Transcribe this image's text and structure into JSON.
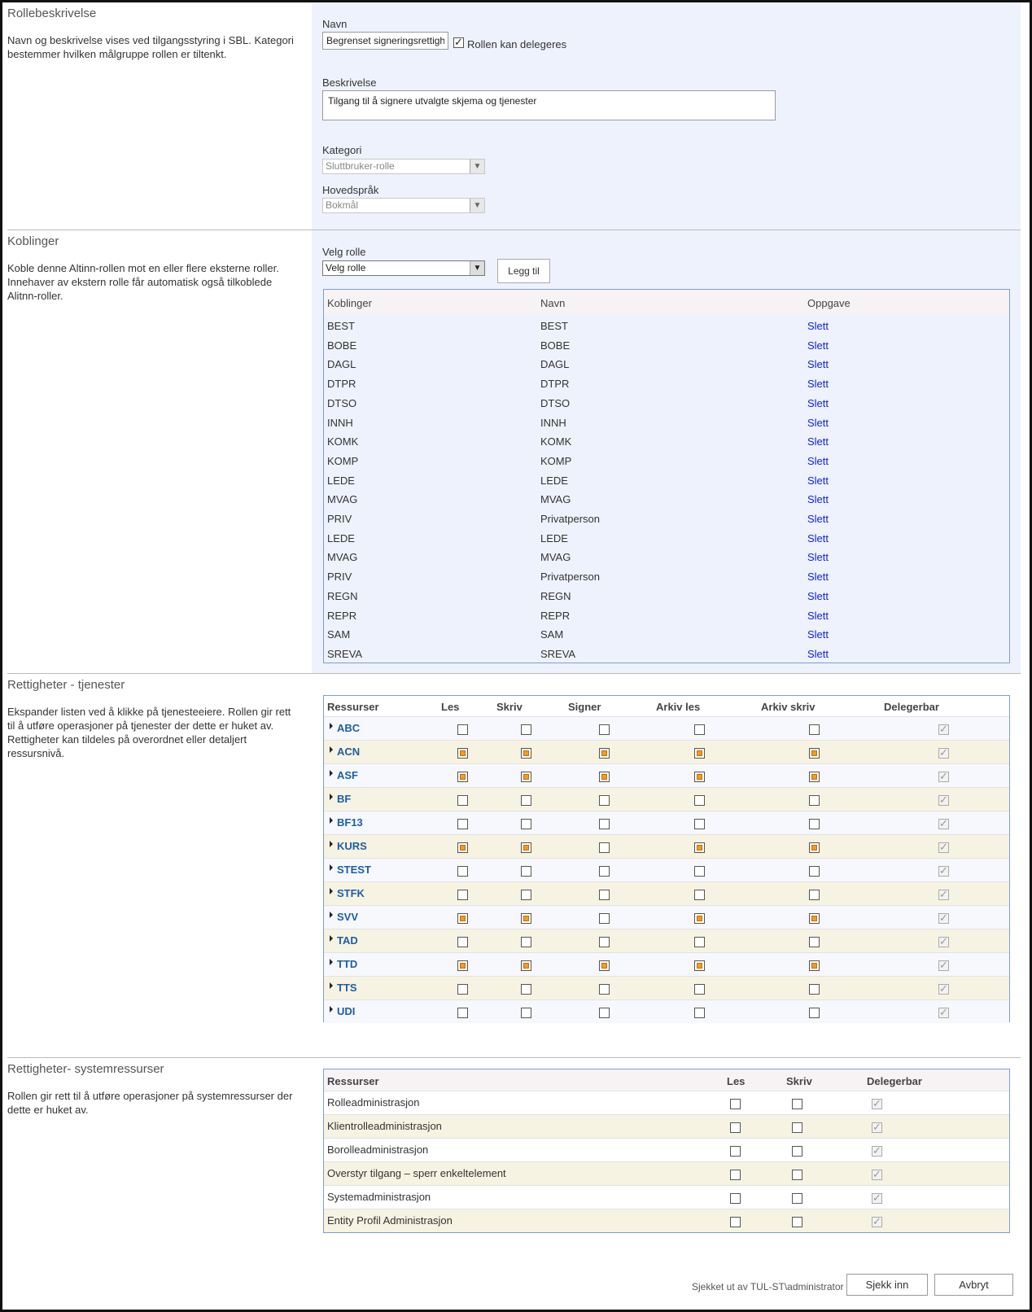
{
  "rollebeskrivelse": {
    "title": "Rollebeskrivelse",
    "description": "Navn og beskrivelse vises ved tilgangsstyring i SBL. Kategori bestemmer hvilken målgruppe rollen er tiltenkt.",
    "navn_label": "Navn",
    "navn_value": "Begrenset signeringsrettigheter",
    "delegeres_label": "Rollen kan delegeres",
    "beskrivelse_label": "Beskrivelse",
    "beskrivelse_value": "Tilgang til å signere utvalgte skjema og tjenester",
    "kategori_label": "Kategori",
    "kategori_value": "Sluttbruker-rolle",
    "hovedsprak_label": "Hovedspråk",
    "hovedsprak_value": "Bokmål"
  },
  "koblinger": {
    "title": "Koblinger",
    "description": "Koble denne Altinn-rollen mot en eller flere eksterne roller. Innehaver av ekstern rolle får automatisk også tilkoblede Alitnn-roller.",
    "velg_label": "Velg rolle",
    "velg_value": "Velg rolle",
    "add_button": "Legg til",
    "columns": [
      "Koblinger",
      "Navn",
      "Oppgave"
    ],
    "rows": [
      {
        "kobling": "BEST",
        "navn": "BEST",
        "action": "Slett"
      },
      {
        "kobling": "BOBE",
        "navn": "BOBE",
        "action": "Slett"
      },
      {
        "kobling": "DAGL",
        "navn": "DAGL",
        "action": "Slett"
      },
      {
        "kobling": "DTPR",
        "navn": "DTPR",
        "action": "Slett"
      },
      {
        "kobling": "DTSO",
        "navn": "DTSO",
        "action": "Slett"
      },
      {
        "kobling": "INNH",
        "navn": "INNH",
        "action": "Slett"
      },
      {
        "kobling": "KOMK",
        "navn": "KOMK",
        "action": "Slett"
      },
      {
        "kobling": "KOMP",
        "navn": "KOMP",
        "action": "Slett"
      },
      {
        "kobling": "LEDE",
        "navn": "LEDE",
        "action": "Slett"
      },
      {
        "kobling": "MVAG",
        "navn": "MVAG",
        "action": "Slett"
      },
      {
        "kobling": "PRIV",
        "navn": "Privatperson",
        "action": "Slett"
      },
      {
        "kobling": "LEDE",
        "navn": "LEDE",
        "action": "Slett"
      },
      {
        "kobling": "MVAG",
        "navn": "MVAG",
        "action": "Slett"
      },
      {
        "kobling": "PRIV",
        "navn": "Privatperson",
        "action": "Slett"
      },
      {
        "kobling": "REGN",
        "navn": "REGN",
        "action": "Slett"
      },
      {
        "kobling": "REPR",
        "navn": "REPR",
        "action": "Slett"
      },
      {
        "kobling": "SAM",
        "navn": "SAM",
        "action": "Slett"
      },
      {
        "kobling": "SREVA",
        "navn": "SREVA",
        "action": "Slett"
      }
    ]
  },
  "tjenester": {
    "title": "Rettigheter - tjenester",
    "description": "Ekspander listen ved å klikke på tjenesteeiere. Rollen gir rett til å utføre operasjoner på tjenester der dette er huket av. Rettigheter kan tildeles på overordnet eller detaljert ressursnivå.",
    "columns": [
      "Ressurser",
      "Les",
      "Skriv",
      "Signer",
      "Arkiv les",
      "Arkiv skriv",
      "Delegerbar"
    ],
    "rows": [
      {
        "name": "ABC",
        "states": [
          "empty",
          "empty",
          "empty",
          "empty",
          "empty"
        ]
      },
      {
        "name": "ACN",
        "states": [
          "orange",
          "orange",
          "orange",
          "orange",
          "orange"
        ]
      },
      {
        "name": "ASF",
        "states": [
          "orange",
          "orange",
          "orange",
          "orange",
          "orange"
        ]
      },
      {
        "name": "BF",
        "states": [
          "empty",
          "empty",
          "empty",
          "empty",
          "empty"
        ]
      },
      {
        "name": "BF13",
        "states": [
          "empty",
          "empty",
          "empty",
          "empty",
          "empty"
        ]
      },
      {
        "name": "KURS",
        "states": [
          "orange",
          "orange",
          "empty",
          "orange",
          "orange"
        ]
      },
      {
        "name": "STEST",
        "states": [
          "empty",
          "empty",
          "empty",
          "empty",
          "empty"
        ]
      },
      {
        "name": "STFK",
        "states": [
          "empty",
          "empty",
          "empty",
          "empty",
          "empty"
        ]
      },
      {
        "name": "SVV",
        "states": [
          "orange",
          "orange",
          "empty",
          "orange",
          "orange"
        ]
      },
      {
        "name": "TAD",
        "states": [
          "empty",
          "empty",
          "empty",
          "empty",
          "empty"
        ]
      },
      {
        "name": "TTD",
        "states": [
          "orange",
          "orange",
          "orange",
          "orange",
          "orange"
        ]
      },
      {
        "name": "TTS",
        "states": [
          "empty",
          "empty",
          "empty",
          "empty",
          "empty"
        ]
      },
      {
        "name": "UDI",
        "states": [
          "empty",
          "empty",
          "empty",
          "empty",
          "empty"
        ]
      }
    ]
  },
  "systemressurser": {
    "title": "Rettigheter- systemressurser",
    "description": "Rollen gir rett til å utføre operasjoner på systemressurser der dette er huket av.",
    "columns": [
      "Ressurser",
      "Les",
      "Skriv",
      "Delegerbar"
    ],
    "rows": [
      "Rolleadministrasjon",
      "Klientrolleadministrasjon",
      "Borolleadministrasjon",
      "Overstyr tilgang – sperr enkeltelement",
      "Systemadministrasjon",
      "Entity Profil Administrasjon"
    ]
  },
  "footer": {
    "status": "Sjekket ut av TUL-ST\\administrator",
    "checkin_button": "Sjekk inn",
    "cancel_button": "Avbryt"
  },
  "colors": {
    "panel_bg": "#eef2fc",
    "link": "#1122dd",
    "service_name": "#1b5ea8",
    "checked_orange": "#f49b1c",
    "table_border": "#7a9fcf",
    "alt_row": "#f7f3e2"
  }
}
